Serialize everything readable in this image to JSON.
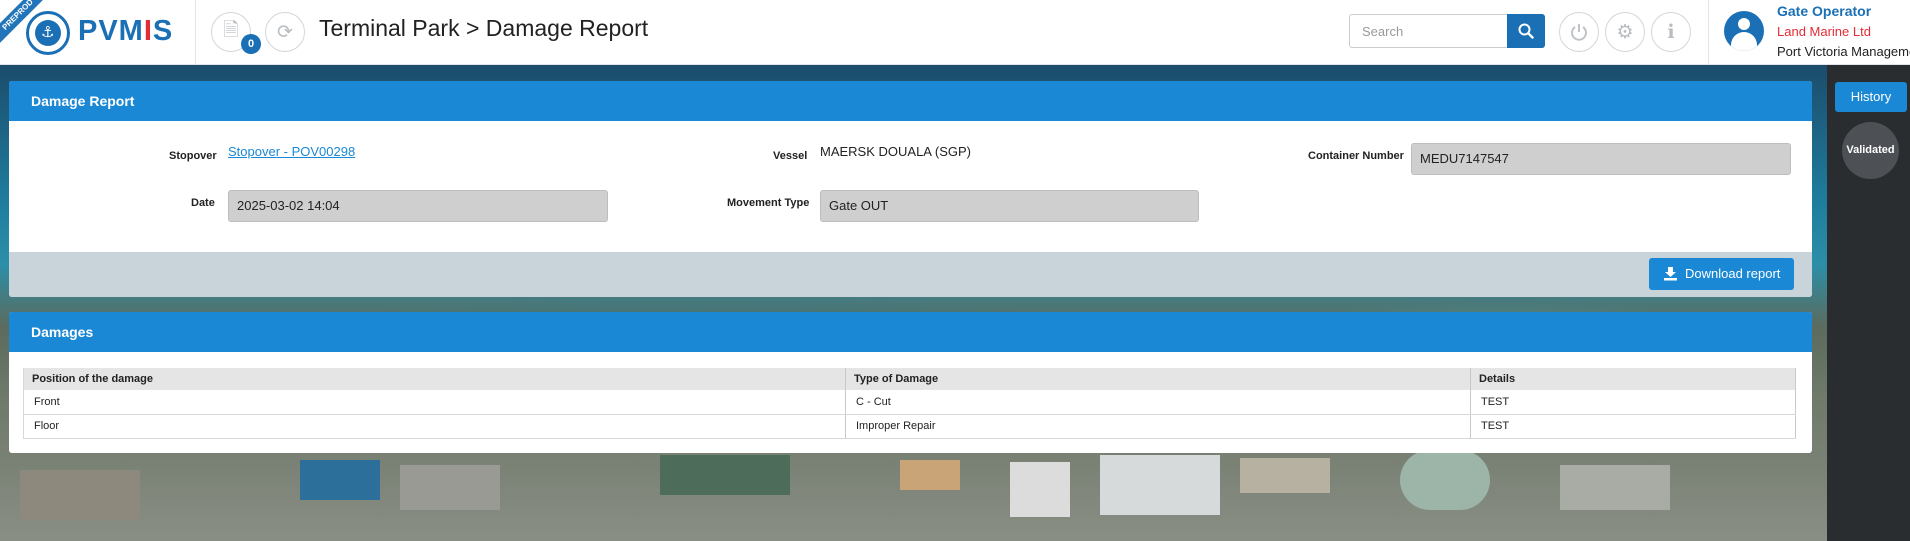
{
  "env_ribbon": "PREPROD",
  "logo": {
    "prefix": "PVM",
    "accent": "I",
    "suffix": "S"
  },
  "header": {
    "notification_count": "0",
    "breadcrumb": "Terminal Park > Damage Report",
    "search_placeholder": "Search"
  },
  "user": {
    "role": "Gate Operator",
    "company": "Land Marine Ltd",
    "organization": "Port Victoria Management"
  },
  "side_panel": {
    "history_label": "History",
    "status_label": "Validated"
  },
  "report": {
    "title": "Damage Report",
    "stopover_label": "Stopover",
    "stopover_value": "Stopover - POV00298",
    "vessel_label": "Vessel",
    "vessel_value": "MAERSK DOUALA (SGP)",
    "container_label": "Container Number",
    "container_value": "MEDU7147547",
    "date_label": "Date",
    "date_value": "2025-03-02 14:04",
    "movement_label": "Movement Type",
    "movement_value": "Gate OUT",
    "download_label": "Download report"
  },
  "damages": {
    "title": "Damages",
    "columns": [
      "Position of the damage",
      "Type of Damage",
      "Details"
    ],
    "rows": [
      [
        "Front",
        "C - Cut",
        "TEST"
      ],
      [
        "Floor",
        "Improper Repair",
        "TEST"
      ]
    ]
  },
  "colors": {
    "brand_blue": "#1a6fb5",
    "header_blue": "#1a88d5",
    "accent_red": "#e32c36"
  }
}
